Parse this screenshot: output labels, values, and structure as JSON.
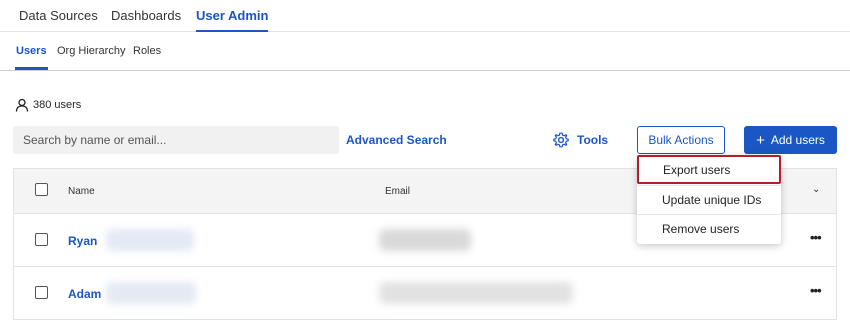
{
  "top_nav": {
    "tabs": [
      {
        "label": "Data Sources",
        "active": false
      },
      {
        "label": "Dashboards",
        "active": false
      },
      {
        "label": "User Admin",
        "active": true
      }
    ]
  },
  "sub_nav": {
    "tabs": [
      {
        "label": "Users",
        "active": true
      },
      {
        "label": "Org Hierarchy",
        "active": false
      },
      {
        "label": "Roles",
        "active": false
      }
    ]
  },
  "user_count": {
    "icon": "person-icon",
    "label": "380 users"
  },
  "search": {
    "placeholder": "Search by name or email...",
    "value": ""
  },
  "advanced_search_label": "Advanced Search",
  "toolbar": {
    "tools_label": "Tools",
    "tools_icon": "gear-icon",
    "bulk_actions_label": "Bulk Actions",
    "add_users_label": "Add users",
    "add_icon": "plus-icon"
  },
  "bulk_menu": {
    "items": [
      {
        "label": "Export users",
        "highlighted": true
      },
      {
        "label": "Update unique IDs",
        "highlighted": false
      },
      {
        "label": "Remove users",
        "highlighted": false
      }
    ]
  },
  "table": {
    "columns": [
      "Name",
      "Email"
    ],
    "rows": [
      {
        "name": "Ryan"
      },
      {
        "name": "Adam"
      }
    ]
  },
  "colors": {
    "accent": "#1a56c4",
    "highlight_border": "#b0202a"
  }
}
